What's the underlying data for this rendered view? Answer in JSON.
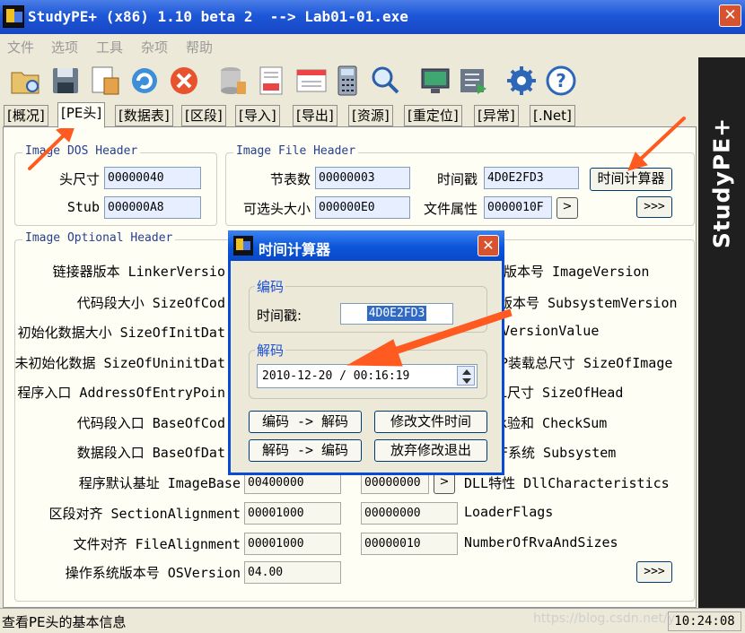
{
  "app": {
    "title": "StudyPE+ (x86) 1.10 beta 2  --> Lab01-01.exe",
    "brand": "StudyPE+"
  },
  "menu": [
    "文件",
    "选项",
    "工具",
    "杂项",
    "帮助"
  ],
  "toolbar": [
    "open-icon",
    "save-icon",
    "document-view-icon",
    "refresh-icon",
    "close-file-icon",
    "database-icon",
    "asm-icon",
    "asm-window-icon",
    "calculator-icon",
    "search-icon",
    "monitor-icon",
    "export-icon",
    "settings-icon",
    "help-icon"
  ],
  "tabs": [
    "[概况]",
    "[PE头]",
    "[数据表]",
    "[区段]",
    "[导入]",
    "[导出]",
    "[资源]",
    "[重定位]",
    "[异常]",
    "[.Net]"
  ],
  "dos_header": {
    "title": "Image DOS Header",
    "rows": [
      {
        "label": "头尺寸",
        "value": "00000040"
      },
      {
        "label": "Stub",
        "value": "000000A8"
      }
    ]
  },
  "file_header": {
    "title": "Image File Header",
    "section_count": {
      "label": "节表数",
      "value": "00000003"
    },
    "optional_size": {
      "label": "可选头大小",
      "value": "000000E0"
    },
    "timestamp": {
      "label": "时间戳",
      "value": "4D0E2FD3"
    },
    "attributes": {
      "label": "文件属性",
      "value": "0000010F"
    },
    "calc_button": "时间计算器",
    "expand_button": ">>>"
  },
  "optional_header": {
    "title": "Image Optional Header",
    "left_labels": [
      "链接器版本 LinkerVersio",
      "代码段大小 SizeOfCod",
      "初始化数据大小 SizeOfInitDat",
      "未初始化数据 SizeOfUninitDat",
      "程序入口 AddressOfEntryPoin",
      "代码段入口 BaseOfCod",
      "数据段入口 BaseOfDat",
      "程序默认基址 ImageBase",
      "区段对齐 SectionAlignment",
      "文件对齐 FileAlignment",
      "操作系统版本号 OSVersion"
    ],
    "left_values": [
      "00400000",
      "00001000",
      "00001000",
      "04.00"
    ],
    "right_values": [
      "00000000",
      "00000000",
      "00000010"
    ],
    "right_labels": [
      "R版本号 ImageVersion",
      "版本号 SubsystemVersion",
      "VersionValue",
      "P装载总尺寸 SizeOfImage",
      "L尺寸 SizeOfHead",
      "k验和 CheckSum",
      "F系统 Subsystem",
      "DLL特性 DllCharacteristics",
      "LoaderFlags",
      "NumberOfRvaAndSizes"
    ],
    "more_button": ">>>"
  },
  "dialog": {
    "title": "时间计算器",
    "encode_group": "编码",
    "timestamp_label": "时间戳:",
    "timestamp_value": "4D0E2FD3",
    "decode_group": "解码",
    "datetime_value": "2010-12-20 / 00:16:19",
    "buttons": [
      "编码 -> 解码",
      "修改文件时间",
      "解码 -> 编码",
      "放弃修改退出"
    ]
  },
  "status": {
    "text": "查看PE头的基本信息",
    "watermark": "https://blog.csdn.net/y",
    "time": "10:24:08"
  },
  "colors": {
    "title_blue": "#1d57d8",
    "arrow_orange": "#ff5a1f",
    "field_blue": "#e6eeff"
  }
}
